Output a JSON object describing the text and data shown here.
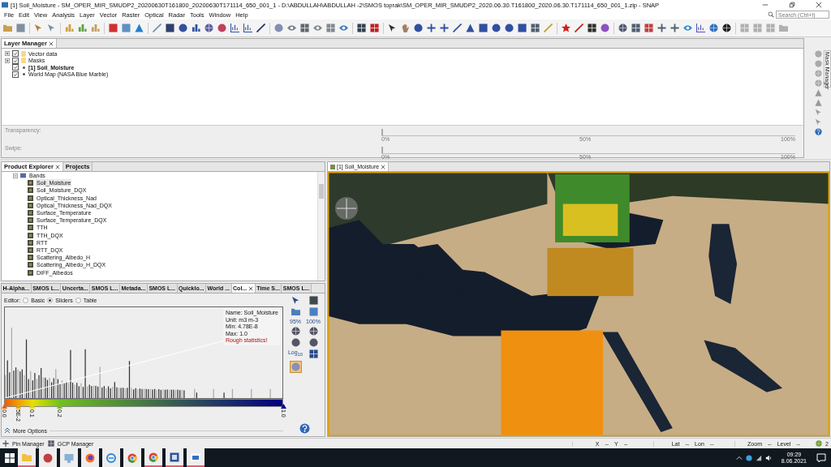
{
  "window": {
    "title": "[1] Soil_Moisture - SM_OPER_MIR_SMUDP2_20200630T161800_20200630T171114_650_001_1 - D:\\ABDULLAH\\ABDULLAH -2\\SMOS toprak\\SM_OPER_MIR_SMUDP2_2020.06.30.T161800_2020.06.30.T171114_650_001_1.zip - SNAP"
  },
  "menu": [
    "File",
    "Edit",
    "View",
    "Analysis",
    "Layer",
    "Vector",
    "Raster",
    "Optical",
    "Radar",
    "Tools",
    "Window",
    "Help"
  ],
  "search": {
    "placeholder": "Search (Ctrl+I)"
  },
  "layer_manager": {
    "title": "Layer Manager",
    "layers": [
      {
        "label": "Vector data",
        "kind": "folder",
        "checked": true,
        "selected": false
      },
      {
        "label": "Masks",
        "kind": "folder",
        "checked": true,
        "selected": false
      },
      {
        "label": "[1] Soil_Moisture",
        "kind": "layer",
        "checked": true,
        "selected": true
      },
      {
        "label": "World Map (NASA Blue Marble)",
        "kind": "layer",
        "checked": true,
        "selected": false
      }
    ],
    "sliders": [
      {
        "label": "Transparency:",
        "level": 0,
        "ticks": [
          "0%",
          "50%",
          "100%"
        ]
      },
      {
        "label": "Swipe:",
        "level": 0,
        "ticks": [
          "0%",
          "50%",
          "100%"
        ]
      }
    ],
    "side_tab": "Mask Manager"
  },
  "explorer": {
    "tabs": [
      {
        "label": "Product Explorer",
        "selected": true
      },
      {
        "label": "Projects",
        "selected": false
      }
    ],
    "group": "Bands",
    "bands": [
      {
        "label": "Soil_Moisture",
        "selected": true
      },
      {
        "label": "Soil_Moisture_DQX",
        "selected": false
      },
      {
        "label": "Optical_Thickness_Nad",
        "selected": false
      },
      {
        "label": "Optical_Thickness_Nad_DQX",
        "selected": false
      },
      {
        "label": "Surface_Temperature",
        "selected": false
      },
      {
        "label": "Surface_Temperature_DQX",
        "selected": false
      },
      {
        "label": "TTH",
        "selected": false
      },
      {
        "label": "TTH_DQX",
        "selected": false
      },
      {
        "label": "RTT",
        "selected": false
      },
      {
        "label": "RTT_DQX",
        "selected": false
      },
      {
        "label": "Scattering_Albedo_H",
        "selected": false
      },
      {
        "label": "Scattering_Albedo_H_DQX",
        "selected": false
      },
      {
        "label": "DIFF_Albedos",
        "selected": false
      }
    ]
  },
  "tool_tabs": [
    {
      "label": "H-Alpha...",
      "selected": false
    },
    {
      "label": "SMOS L...",
      "selected": false
    },
    {
      "label": "Uncerta...",
      "selected": false
    },
    {
      "label": "SMOS L...",
      "selected": false
    },
    {
      "label": "Metada...",
      "selected": false
    },
    {
      "label": "SMOS L...",
      "selected": false
    },
    {
      "label": "Quicklo...",
      "selected": false
    },
    {
      "label": "World ...",
      "selected": false
    },
    {
      "label": "Col...",
      "selected": true
    },
    {
      "label": "Time S...",
      "selected": false
    },
    {
      "label": "SMOS L...",
      "selected": false
    }
  ],
  "color_manipulation": {
    "editor_label": "Editor:",
    "editor_options": [
      {
        "label": "Basic",
        "selected": false
      },
      {
        "label": "Sliders",
        "selected": true
      },
      {
        "label": "Table",
        "selected": false
      }
    ],
    "info": [
      {
        "text": "Name: Soil_Moisture",
        "kind": "plain"
      },
      {
        "text": "Unit: m3 m-3",
        "kind": "plain"
      },
      {
        "text": "Min: 4.78E-8",
        "kind": "plain"
      },
      {
        "text": "Max: 1.0",
        "kind": "plain"
      },
      {
        "text": "Rough statistics!",
        "kind": "warning"
      }
    ],
    "points": [
      {
        "label": "0.0",
        "level": 0,
        "color": "#e8600a"
      },
      {
        "label": "5E-2",
        "level": 0.05,
        "color": "#f0a000"
      },
      {
        "label": "0.1",
        "level": 0.1,
        "color": "#e8e000"
      },
      {
        "label": "0.2",
        "level": 0.2,
        "color": "#70c020"
      },
      {
        "label": "1.0",
        "level": 1,
        "color": "#000080"
      }
    ],
    "zoom_labels": [
      "95%",
      "100%"
    ],
    "log_label": "Log$_{10}$",
    "more_options": "More Options"
  },
  "view": {
    "tab": "[1] Soil_Moisture"
  },
  "status_bar": {
    "tools": [
      "Pin Manager",
      "GCP Manager"
    ],
    "groups": [
      [
        {
          "label": "X",
          "value": "--"
        },
        {
          "label": "Y",
          "value": "--"
        }
      ],
      [
        {
          "label": "Lat",
          "value": "--"
        },
        {
          "label": "Lon",
          "value": "--"
        }
      ],
      [
        {
          "label": "Zoom",
          "value": "--"
        },
        {
          "label": "Level",
          "value": "--"
        }
      ]
    ],
    "badge": "2"
  },
  "taskbar": {
    "apps": [
      {
        "kind": "folder",
        "running": true
      },
      {
        "kind": "network",
        "running": false
      },
      {
        "kind": "computer",
        "running": false
      },
      {
        "kind": "firefox",
        "running": false
      },
      {
        "kind": "ie",
        "running": false
      },
      {
        "kind": "chrome",
        "running": false
      },
      {
        "kind": "chrome",
        "running": true
      },
      {
        "kind": "word",
        "running": true
      },
      {
        "kind": "snap",
        "running": true
      }
    ],
    "time": "09:29",
    "date": "8.06.2021"
  }
}
